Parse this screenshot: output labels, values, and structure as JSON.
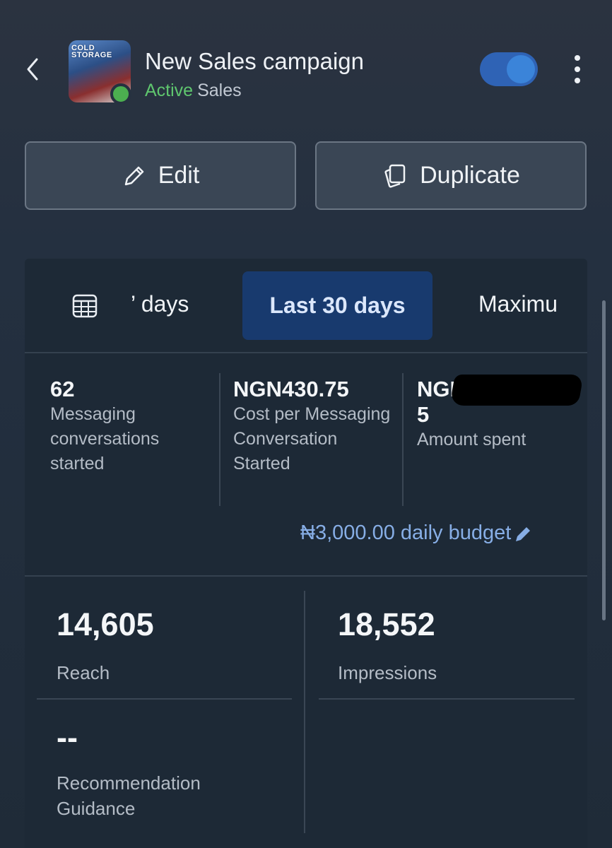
{
  "header": {
    "thumbnail_text": "COLD STORAGE",
    "title": "New Sales campaign",
    "status": "Active",
    "objective": "Sales",
    "toggle_on": true
  },
  "actions": {
    "edit_label": "Edit",
    "duplicate_label": "Duplicate"
  },
  "date_tabs": {
    "tab_7_label": "’ days",
    "tab_30_label": "Last 30 days",
    "tab_max_label": "Maximu",
    "selected": "Last 30 days"
  },
  "metrics": {
    "conversations_value": "62",
    "conversations_label": "Messaging conversations started",
    "cost_value": "NGN430.75",
    "cost_label": "Cost per Messaging Conversation Started",
    "spent_value_visible": "NGN",
    "spent_value_tail": "5",
    "spent_label": "Amount spent",
    "budget_text": "₦3,000.00 daily budget"
  },
  "stats": {
    "reach_value": "14,605",
    "reach_label": "Reach",
    "impressions_value": "18,552",
    "impressions_label": "Impressions",
    "recommendation_value": "--",
    "recommendation_label": "Recommendation Guidance"
  },
  "colors": {
    "active_green": "#5fc66e",
    "selected_tab_bg": "#183a6e",
    "toggle_blue": "#2f63b5",
    "budget_link": "#87aee6"
  }
}
